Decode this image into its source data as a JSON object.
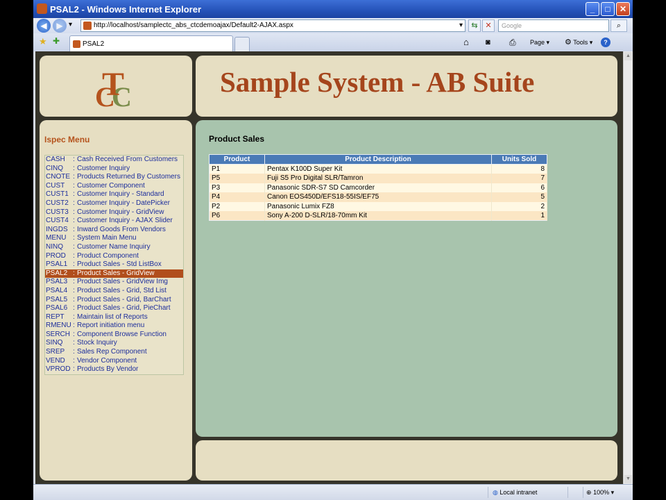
{
  "window": {
    "title": "PSAL2 - Windows Internet Explorer",
    "minimize": "_",
    "maximize": "□",
    "close": "✕"
  },
  "address": {
    "url": "http://localhost/samplectc_abs_ctcdemoajax/Default2-AJAX.aspx",
    "search_placeholder": "Google",
    "back_glyph": "◀",
    "forward_glyph": "▶",
    "refresh_glyph": "⇆",
    "stop_glyph": "✕",
    "dropdown_glyph": "▾",
    "search_glyph": "⌕"
  },
  "tabs": {
    "active_label": "PSAL2",
    "page_label": "Page",
    "tools_label": "Tools",
    "favorites_glyph": "★",
    "add_fav_glyph": "✚",
    "home_glyph": "⌂",
    "feeds_glyph": "◙",
    "print_glyph": "⎙",
    "help_glyph": "?"
  },
  "logo": {
    "t": "T",
    "c1": "C",
    "c2": "C"
  },
  "header": {
    "title": "Sample System - AB Suite"
  },
  "menu": {
    "title": "Ispec Menu",
    "selected": 14,
    "items": [
      {
        "code": "CASH",
        "label": "Cash Received From Customers"
      },
      {
        "code": "CINQ",
        "label": "Customer Inquiry"
      },
      {
        "code": "CNOTE",
        "label": "Products Returned By Customers"
      },
      {
        "code": "CUST",
        "label": "Customer Component"
      },
      {
        "code": "CUST1",
        "label": "Customer Inquiry - Standard"
      },
      {
        "code": "CUST2",
        "label": "Customer Inquiry - DatePicker"
      },
      {
        "code": "CUST3",
        "label": "Customer Inquiry - GridView"
      },
      {
        "code": "CUST4",
        "label": "Customer Inquiry - AJAX Slider"
      },
      {
        "code": "INGDS",
        "label": "Inward Goods From Vendors"
      },
      {
        "code": "MENU",
        "label": "System Main Menu"
      },
      {
        "code": "NINQ",
        "label": "Customer Name Inquiry"
      },
      {
        "code": "PROD",
        "label": "Product Component"
      },
      {
        "code": "PSAL1",
        "label": "Product Sales - Std ListBox"
      },
      {
        "code": "PSAL2",
        "label": "Product Sales - GridView"
      },
      {
        "code": "PSAL3",
        "label": "Product Sales - GridView Img"
      },
      {
        "code": "PSAL4",
        "label": "Product Sales - Grid, Std List"
      },
      {
        "code": "PSAL5",
        "label": "Product Sales - Grid, BarChart"
      },
      {
        "code": "PSAL6",
        "label": "Product Sales - Grid, PieChart"
      },
      {
        "code": "REPT",
        "label": "Maintain list of Reports"
      },
      {
        "code": "RMENU",
        "label": "Report initiation menu"
      },
      {
        "code": "SERCH",
        "label": "Component Browse Function"
      },
      {
        "code": "SINQ",
        "label": "Stock Inquiry"
      },
      {
        "code": "SREP",
        "label": "Sales Rep Component"
      },
      {
        "code": "VEND",
        "label": "Vendor Component"
      },
      {
        "code": "VPROD",
        "label": "Products By Vendor"
      }
    ]
  },
  "main": {
    "title": "Product Sales",
    "columns": [
      "Product",
      "Product Description",
      "Units Sold"
    ],
    "rows": [
      [
        "P1",
        "Pentax K100D Super Kit",
        "8"
      ],
      [
        "P5",
        "Fuji S5 Pro Digital SLR/Tamron",
        "7"
      ],
      [
        "P3",
        "Panasonic SDR-S7 SD Camcorder",
        "6"
      ],
      [
        "P4",
        "Canon EOS450D/EFS18-55IS/EF75",
        "5"
      ],
      [
        "P2",
        "Panasonic Lumix FZ8",
        "2"
      ],
      [
        "P6",
        "Sony A-200 D-SLR/18-70mm Kit",
        "1"
      ]
    ]
  },
  "status": {
    "zone": "Local intranet",
    "zoom": "100%"
  },
  "colors": {
    "accent": "#b14e1c",
    "panel": "#e6dec2",
    "main_bg": "#a8c4ad",
    "grid_header": "#4a7ab6",
    "link": "#1d2e9c"
  }
}
